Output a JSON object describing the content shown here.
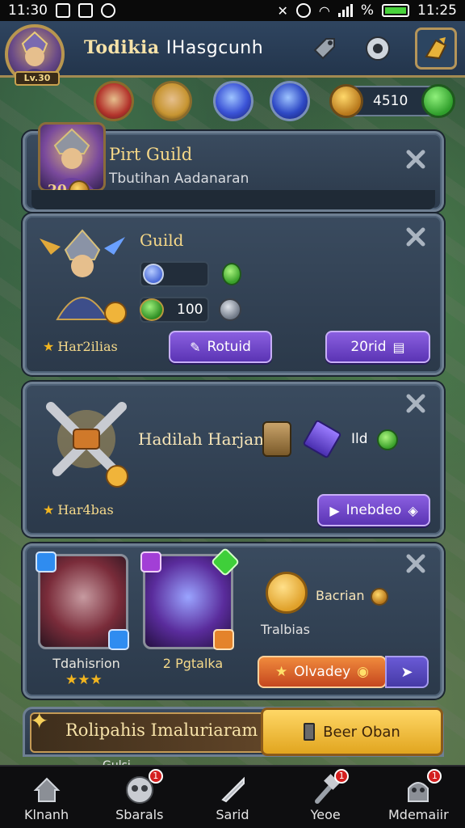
{
  "status_bar": {
    "time_left": "11:30",
    "time_right": "11:25",
    "battery_symbol": "%"
  },
  "header": {
    "avatar_level": "Lv.30",
    "player_name_gold": "Todikia",
    "player_name_white": "IHasgcunh"
  },
  "resources": {
    "gem_value": "4510"
  },
  "panels": {
    "first_guild": {
      "level": "20",
      "title": "Pirt Guild",
      "subtitle": "Tbutihan Aadanaran"
    },
    "guild": {
      "title": "Guild",
      "stat_value": "100",
      "stars": "Har2ilias",
      "reward_button": "Rotuid",
      "second_button": "20rid"
    },
    "daily": {
      "title": "Hadilah Harjan",
      "item_label": "Ild",
      "stars": "Har4bas",
      "button": "Inebdeo"
    },
    "team": {
      "hero1_name": "Tdahisrion",
      "hero1_stars": "★★★",
      "hero2_name": "2 Pgtalka",
      "reward_title": "Bacrian",
      "reward_sub": "Tralbias",
      "button": "Olvadey"
    }
  },
  "banner": {
    "text": "Rolipahis Imaluriaram",
    "button": "Beer Oban",
    "sub": "Gulsi"
  },
  "bottom_nav": [
    {
      "label": "Klnanh",
      "icon": "house-icon",
      "badge": ""
    },
    {
      "label": "Sbarals",
      "icon": "social-icon",
      "badge": "1"
    },
    {
      "label": "Sarid",
      "icon": "sword-icon",
      "badge": ""
    },
    {
      "label": "Yeoe",
      "icon": "hammer-icon",
      "badge": "1"
    },
    {
      "label": "Mdemaiir",
      "icon": "monster-icon",
      "badge": "1"
    }
  ],
  "colors": {
    "accent_gold": "#f6d888",
    "button_purple": "#6b45cc",
    "button_orange": "#e06a2c",
    "panel": "#33445a"
  }
}
